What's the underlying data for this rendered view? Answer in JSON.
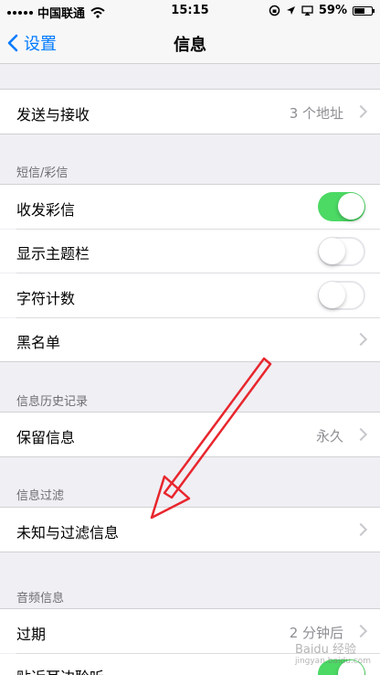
{
  "colors": {
    "accent": "#007aff",
    "toggle_on": "#4cd964",
    "arrow": "#e8262d"
  },
  "status_bar": {
    "carrier": "中国联通",
    "time": "15:15",
    "battery": "59%",
    "battery_level": 0.59
  },
  "nav": {
    "back_label": "设置",
    "title": "信息"
  },
  "rows": {
    "send_receive": {
      "label": "发送与接收",
      "detail": "3 个地址"
    },
    "mms": {
      "label": "收发彩信",
      "on": true
    },
    "subject": {
      "label": "显示主题栏",
      "on": false
    },
    "char_count": {
      "label": "字符计数",
      "on": false
    },
    "blocked": {
      "label": "黑名单"
    },
    "keep": {
      "label": "保留信息",
      "detail": "永久"
    },
    "unknown": {
      "label": "未知与过滤信息"
    },
    "expire": {
      "label": "过期",
      "detail": "2 分钟后"
    },
    "raise_listen": {
      "label": "贴近耳边聆听",
      "on": true
    }
  },
  "sections": {
    "sms_mms": "短信/彩信",
    "history": "信息历史记录",
    "filtering": "信息过滤",
    "audio": "音频信息"
  },
  "watermark": {
    "main": "Baidu 经验",
    "sub": "jingyan.baidu.com"
  }
}
